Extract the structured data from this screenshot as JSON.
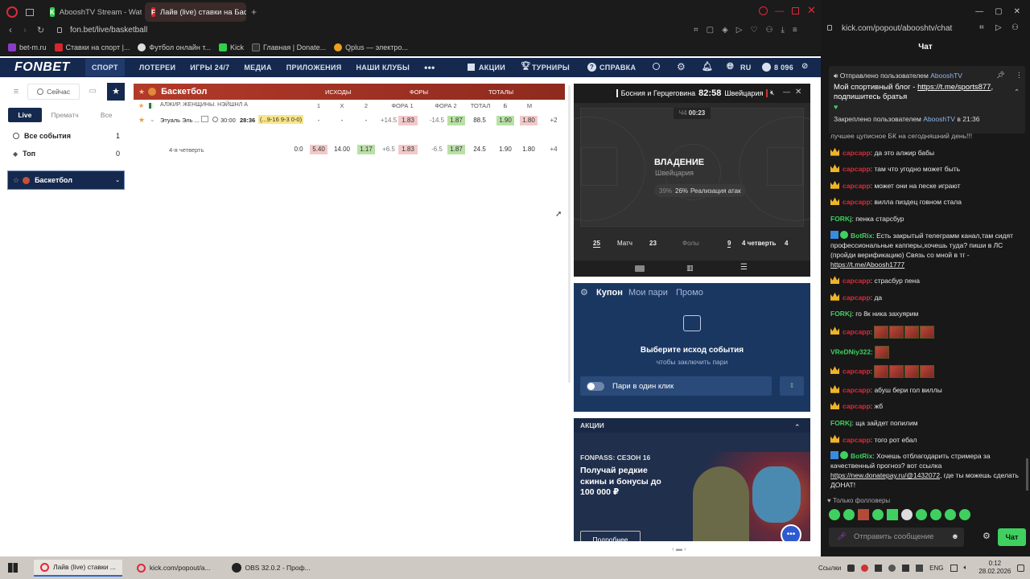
{
  "browser": {
    "tabs": [
      {
        "label": "AbooshTV Stream - Watc"
      },
      {
        "label": "Лайв (live) ставки на Бас"
      }
    ],
    "url": "fon.bet/live/basketball",
    "bookmarks": [
      "bet-m.ru",
      "Ставки на спорт |...",
      "Футбол онлайн т...",
      "Kick",
      "Главная | Donate...",
      "Qplus — электро..."
    ]
  },
  "fonbet_nav": {
    "logo": "FONBET",
    "items": [
      "СПОРТ",
      "ЛОТЕРЕИ",
      "ИГРЫ 24/7",
      "МЕДИА",
      "ПРИЛОЖЕНИЯ",
      "НАШИ КЛУБЫ"
    ],
    "right": [
      "АКЦИИ",
      "ТУРНИРЫ",
      "СПРАВКА"
    ],
    "lang": "RU",
    "balance": "8 096"
  },
  "left_filters": {
    "now": "Сейчас",
    "tabs": [
      "Live",
      "Прематч",
      "Все"
    ],
    "all_events": "Все события",
    "all_events_count": "1",
    "top": "Топ",
    "top_count": "0",
    "sport": "Баскетбол"
  },
  "events": {
    "sport": "Баскетбол",
    "columns": [
      "ИСХОДЫ",
      "ФОРЫ",
      "ТОТАЛЫ"
    ],
    "subcols": [
      "1",
      "X",
      "2",
      "ФОРА 1",
      "ФОРА 2",
      "ТОТАЛ",
      "Б",
      "М"
    ],
    "league": "АЛЖИР. ЖЕНЩИНЫ. НЭЙШНЛ А",
    "match": {
      "team": "Этуаль Эль ...",
      "clock": "30:00",
      "time": "28:36",
      "score": "(...9-16 9-3 0-0)",
      "o1": "-",
      "ox": "-",
      "o2": "-",
      "f1": "+14.5",
      "f1v": "1.83",
      "f2": "-14.5",
      "f2v": "1.87",
      "total": "88.5",
      "b": "1.90",
      "m": "1.80",
      "more": "+2"
    },
    "quarter": {
      "label": "4-я четверть",
      "score": "0:0",
      "o1": "5.40",
      "ox": "14.00",
      "o2": "1.17",
      "f1": "+6.5",
      "f1v": "1.83",
      "f2": "-6.5",
      "f2v": "1.87",
      "total": "24.5",
      "b": "1.90",
      "m": "1.80",
      "more": "+4"
    }
  },
  "scoreboard": {
    "team1": "Босния и Герцеговина",
    "timer": "82:58",
    "team2": "Швейцария",
    "period": "Ч4",
    "period_time": "00:23",
    "possession": "ВЛАДЕНИЕ",
    "possession_team": "Швейцария",
    "pct1": "39%",
    "pct2": "26%",
    "pct_label": "Реализация атак",
    "stats": {
      "left": "25",
      "match": "Матч",
      "mid": "23",
      "fouls": "Фолы",
      "q_left": "9",
      "quarter": "4 четверть",
      "q_right": "4"
    }
  },
  "coupon": {
    "tabs": [
      "Купон",
      "Мои пари",
      "Промо"
    ],
    "title": "Выберите исход события",
    "subtitle": "чтобы заключить пари",
    "one_click": "Пари в один клик"
  },
  "promo": {
    "header": "АКЦИИ",
    "season": "FONPASS: СЕЗОН 16",
    "text": "Получай редкие скины и бонусы до 100 000 ₽",
    "button": "Подробнее"
  },
  "chat": {
    "url": "kick.com/popout/abooshtv/chat",
    "title": "Чат",
    "pinned1_prefix": "Отправлено пользователем",
    "pinned1_user": "AbooshTV",
    "pinned1_text": "Мой спортивный блог -",
    "pinned1_link": "https://t.me/sports877",
    "pinned1_tail": ", подпишитесь братья",
    "pinned2_prefix": "Закреплено пользователем",
    "pinned2_user": "AbooshTV",
    "pinned2_time": "в 21:36",
    "cut_line": "лучшее цуписное БК на сегодняшний день!!!",
    "messages": [
      {
        "user": "сарсарр",
        "text": "да это алжир бабы"
      },
      {
        "user": "сарсарр",
        "text": "там что угодно может быть"
      },
      {
        "user": "сарсарр",
        "text": "может они на песке играют"
      },
      {
        "user": "сарсарр",
        "text": "вилла пиздец говном стала"
      },
      {
        "user": "FORKj",
        "text": "пенка старсбур"
      }
    ],
    "bot1_user": "BotRix",
    "bot1_text": "Есть закрытый телеграмм канал,там сидят профессиональные капперы,хочешь туда? пиши в ЛС (пройди верификацию) Связь со мной в тг -",
    "bot1_link": "https://t.me/Aboosh1777",
    "messages2": [
      {
        "user": "сарсарр",
        "text": "страсбур пена"
      },
      {
        "user": "сарсарр",
        "text": "да"
      },
      {
        "user": "FORKj",
        "text": "го 8к ника захуярим"
      }
    ],
    "emote_user1": "сарсарр",
    "emote_user2": "VReDNiy322",
    "emote_user3": "сарсарр",
    "messages3": [
      {
        "user": "сарсарр",
        "text": "абуш бери гол виллы"
      },
      {
        "user": "сарсарр",
        "text": "жб"
      },
      {
        "user": "FORKj",
        "text": "ща зайдет попилим"
      },
      {
        "user": "сарсарр",
        "text": "того рот ебал"
      }
    ],
    "bot2_user": "BotRix",
    "bot2_text": "Хочешь отблагодарить стримера за качественный прогноз? вот ссылка",
    "bot2_link": "https://new.donatepay.ru/@1432072",
    "bot2_tail": ", где ты можешь сделать ДОНАТ!",
    "followers_only": "Только фолловеры",
    "input_placeholder": "Отправить сообщение",
    "send": "Чат"
  },
  "taskbar": {
    "items": [
      "Лайв (live) ставки ...",
      "kick.com/popout/a...",
      "OBS 32.0.2 - Проф..."
    ],
    "links": "Ссылки",
    "lang": "ENG",
    "time": "0:12",
    "date": "28.02.2026"
  }
}
